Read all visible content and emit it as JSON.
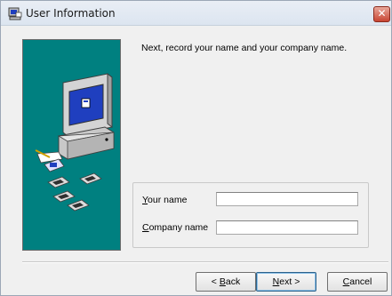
{
  "window": {
    "title": "User Information",
    "close_label": "✕"
  },
  "intro_text": "Next, record your name and your company name.",
  "form": {
    "name_label_first": "Y",
    "name_label_rest": "our name",
    "name_value": "",
    "company_label_first": "C",
    "company_label_rest": "ompany name",
    "company_value": ""
  },
  "buttons": {
    "back_prefix": "< ",
    "back_first": "B",
    "back_rest": "ack",
    "next_first": "N",
    "next_rest": "ext >",
    "cancel_first": "C",
    "cancel_rest": "ancel"
  },
  "colors": {
    "panel": "#008080",
    "close": "#c84532"
  }
}
